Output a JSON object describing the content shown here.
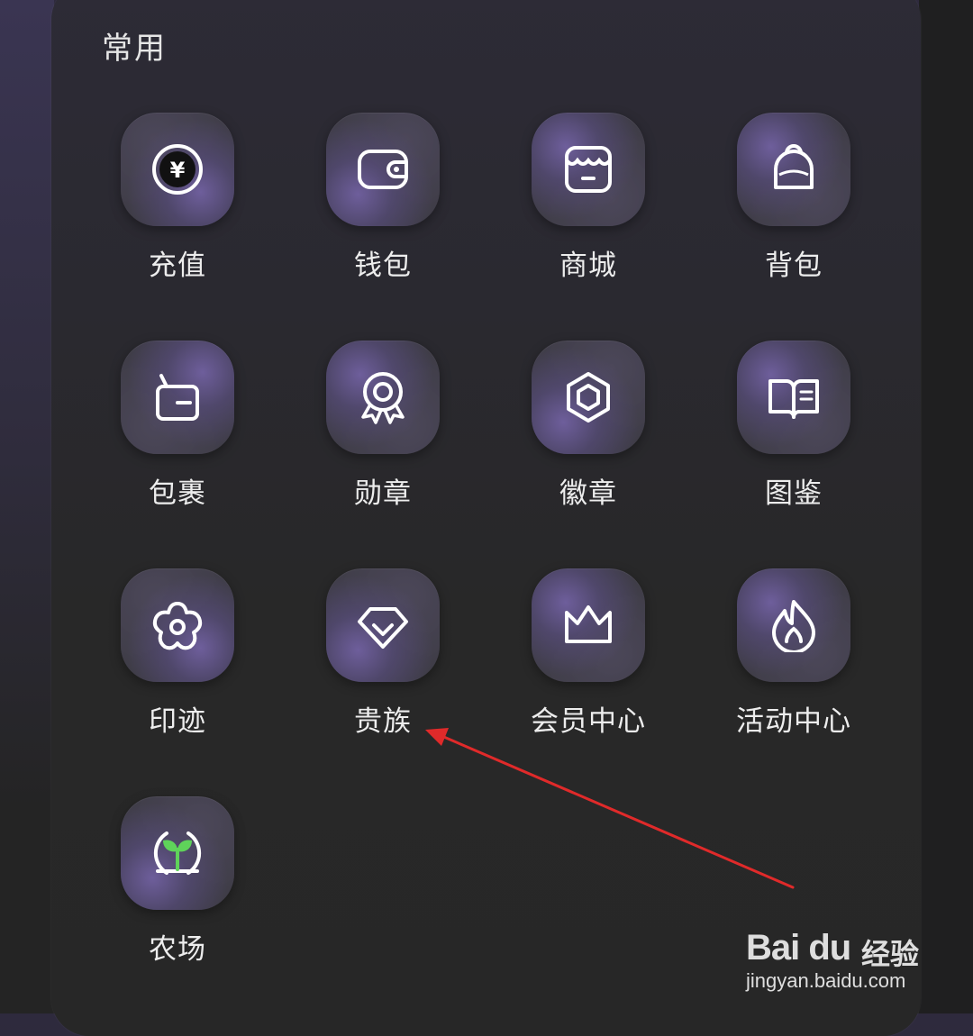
{
  "section": {
    "title": "常用"
  },
  "items": [
    {
      "label": "充值",
      "icon": "yuan-coin-icon"
    },
    {
      "label": "钱包",
      "icon": "wallet-icon"
    },
    {
      "label": "商城",
      "icon": "store-icon"
    },
    {
      "label": "背包",
      "icon": "backpack-icon"
    },
    {
      "label": "包裹",
      "icon": "package-icon"
    },
    {
      "label": "勋章",
      "icon": "medal-icon"
    },
    {
      "label": "徽章",
      "icon": "hexagon-badge-icon"
    },
    {
      "label": "图鉴",
      "icon": "book-icon"
    },
    {
      "label": "印迹",
      "icon": "flower-icon"
    },
    {
      "label": "贵族",
      "icon": "diamond-icon"
    },
    {
      "label": "会员中心",
      "icon": "crown-icon"
    },
    {
      "label": "活动中心",
      "icon": "flame-icon"
    },
    {
      "label": "农场",
      "icon": "sprout-icon"
    }
  ],
  "annotation": {
    "arrow_color": "#e02a2a",
    "points_to": "贵族"
  },
  "watermark": {
    "logo": "Bai du",
    "text": "经验",
    "url": "jingyan.baidu.com"
  },
  "colors": {
    "icon_stroke": "#ffffff",
    "sprout_green": "#5fd35a",
    "label": "#ededed"
  }
}
